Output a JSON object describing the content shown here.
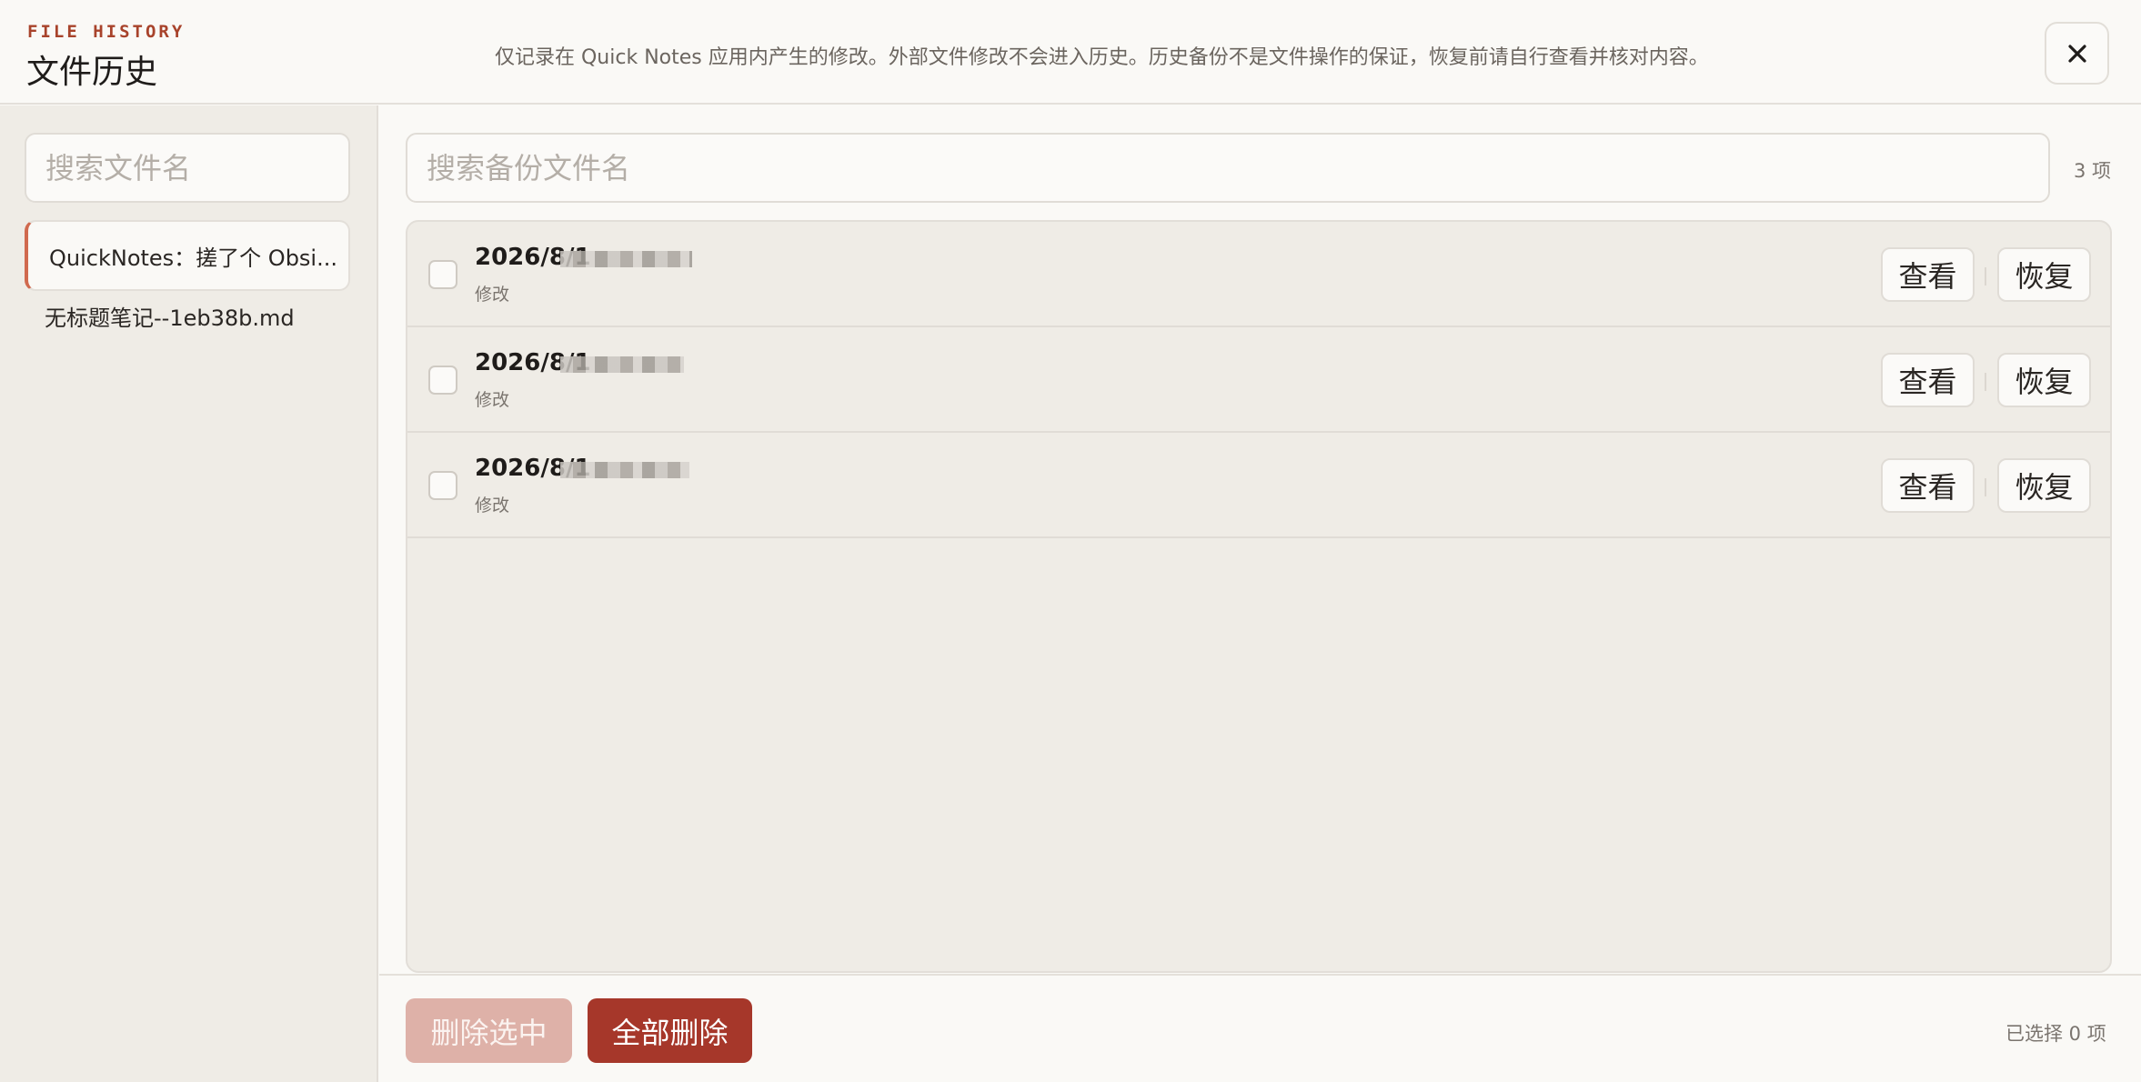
{
  "header": {
    "eyebrow": "FILE HISTORY",
    "title": "文件历史",
    "notice": "仅记录在 Quick Notes 应用内产生的修改。外部文件修改不会进入历史。历史备份不是文件操作的保证，恢复前请自行查看并核对内容。",
    "close_icon": "close-icon"
  },
  "sidebar": {
    "search_placeholder": "搜索文件名",
    "files": [
      {
        "label": "QuickNotes：搓了个 Obsi...",
        "active": true
      },
      {
        "label": "无标题笔记--1eb38b.md",
        "active": false
      }
    ]
  },
  "main": {
    "search_placeholder": "搜索备份文件名",
    "count": "3 项",
    "backups": [
      {
        "timestamp": "2026/8/1",
        "kind": "修改",
        "view_label": "查看",
        "restore_label": "恢复"
      },
      {
        "timestamp": "2026/8/1",
        "kind": "修改",
        "view_label": "查看",
        "restore_label": "恢复"
      },
      {
        "timestamp": "2026/8/1",
        "kind": "修改",
        "view_label": "查看",
        "restore_label": "恢复"
      }
    ]
  },
  "footer": {
    "delete_selected_label": "删除选中",
    "delete_all_label": "全部删除",
    "selected_count": "已选择 0 项"
  },
  "colors": {
    "accent": "#a6372a",
    "accent_muted": "#deb1a8",
    "active_border": "#d06a4f"
  }
}
